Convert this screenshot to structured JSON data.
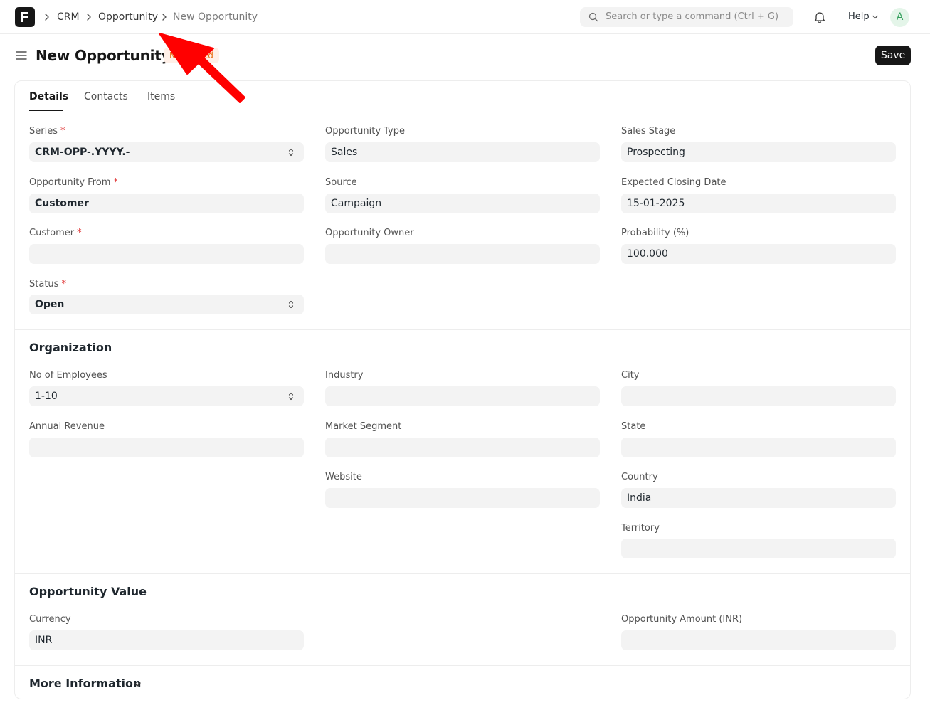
{
  "navbar": {
    "logo": "frappe-logo",
    "breadcrumbs": [
      {
        "label": "CRM"
      },
      {
        "label": "Opportunity"
      },
      {
        "label": "New Opportunity"
      }
    ],
    "search_placeholder": "Search or type a command (Ctrl + G)",
    "help_label": "Help",
    "avatar_initial": "A"
  },
  "page": {
    "title": "New Opportunity",
    "status": "Not Saved",
    "save_label": "Save"
  },
  "tabs": [
    {
      "label": "Details",
      "active": true
    },
    {
      "label": "Contacts",
      "active": false
    },
    {
      "label": "Items",
      "active": false
    }
  ],
  "details": {
    "series": {
      "label": "Series",
      "value": "CRM-OPP-.YYYY.-"
    },
    "opportunity_from": {
      "label": "Opportunity From",
      "value": "Customer"
    },
    "customer": {
      "label": "Customer",
      "value": ""
    },
    "status": {
      "label": "Status",
      "value": "Open"
    },
    "opportunity_type": {
      "label": "Opportunity Type",
      "value": "Sales"
    },
    "source": {
      "label": "Source",
      "value": "Campaign"
    },
    "opportunity_owner": {
      "label": "Opportunity Owner",
      "value": ""
    },
    "sales_stage": {
      "label": "Sales Stage",
      "value": "Prospecting"
    },
    "expected_closing_date": {
      "label": "Expected Closing Date",
      "value": "15-01-2025"
    },
    "probability": {
      "label": "Probability (%)",
      "value": "100.000"
    }
  },
  "organization": {
    "title": "Organization",
    "no_of_employees": {
      "label": "No of Employees",
      "value": "1-10"
    },
    "annual_revenue": {
      "label": "Annual Revenue",
      "value": ""
    },
    "industry": {
      "label": "Industry",
      "value": ""
    },
    "market_segment": {
      "label": "Market Segment",
      "value": ""
    },
    "website": {
      "label": "Website",
      "value": ""
    },
    "city": {
      "label": "City",
      "value": ""
    },
    "state": {
      "label": "State",
      "value": ""
    },
    "country": {
      "label": "Country",
      "value": "India"
    },
    "territory": {
      "label": "Territory",
      "value": ""
    }
  },
  "opportunity_value": {
    "title": "Opportunity Value",
    "currency": {
      "label": "Currency",
      "value": "INR"
    },
    "opportunity_amount": {
      "label": "Opportunity Amount (INR)",
      "value": ""
    }
  },
  "more_information": {
    "title": "More Information"
  },
  "colors": {
    "required_marker": "#e03636",
    "field_bg": "#f3f3f3",
    "primary_button": "#171717",
    "annotation_arrow": "#ff0000"
  }
}
